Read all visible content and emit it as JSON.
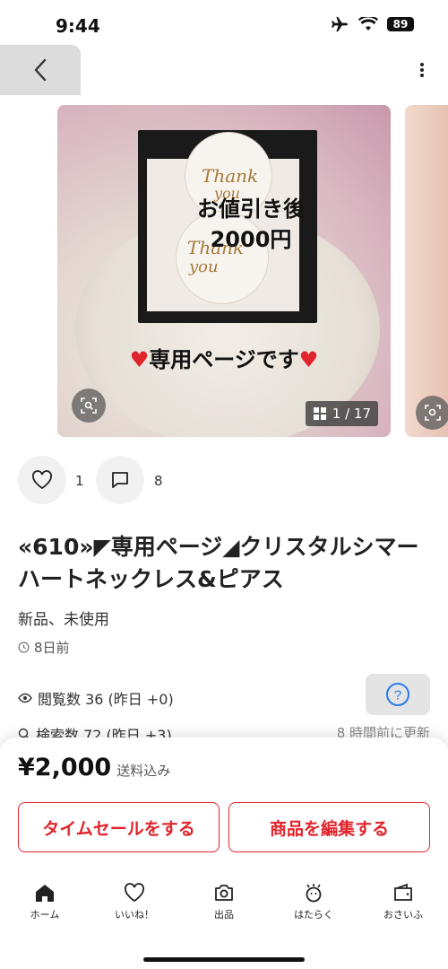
{
  "status_bar": {
    "time": "9:44",
    "battery": "89"
  },
  "gallery": {
    "overlay_line1": "お値引き後",
    "overlay_line2": "2000円",
    "overlay_banner": "専用ページです",
    "tag_text_1a": "Thank",
    "tag_text_1b": "you",
    "tag_text_2a": "Thank",
    "tag_text_2b": "you",
    "counter": "1 / 17"
  },
  "actions": {
    "likes": "1",
    "comments": "8"
  },
  "item": {
    "title": "«610»◤専用ページ◢クリスタルシマーハートネックレス&ピアス",
    "condition": "新品、未使用",
    "posted": "8日前"
  },
  "stats": {
    "views": "閲覧数  36 (昨日 +0)",
    "searches": "検索数  72 (昨日 +3)",
    "updated": "8 時間前に更新"
  },
  "price": {
    "value": "¥2,000",
    "note": "送料込み"
  },
  "buttons": {
    "timesale": "タイムセールをする",
    "edit": "商品を編集する"
  },
  "tabbar": {
    "items": [
      {
        "label": "ホーム",
        "icon": "home-icon"
      },
      {
        "label": "いいね！",
        "icon": "heart-icon"
      },
      {
        "label": "出品",
        "icon": "camera-icon"
      },
      {
        "label": "はたらく",
        "icon": "work-icon"
      },
      {
        "label": "おさいふ",
        "icon": "wallet-icon"
      }
    ]
  },
  "colors": {
    "accent": "#e0242b",
    "sheet_bg": "#ffffff"
  }
}
